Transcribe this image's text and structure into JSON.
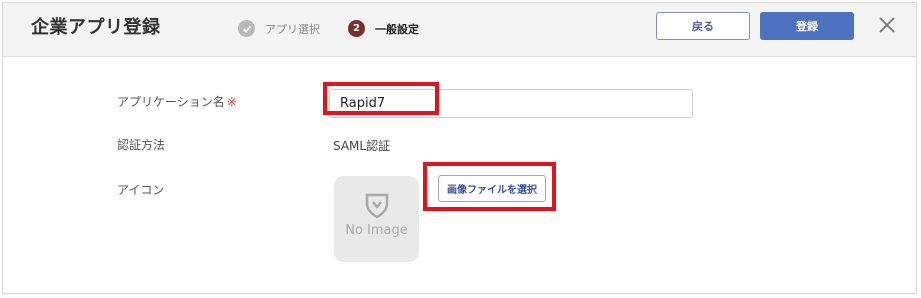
{
  "header": {
    "title": "企業アプリ登録",
    "steps": [
      {
        "number": "✓",
        "label": "アプリ選択",
        "state": "done"
      },
      {
        "number": "2",
        "label": "一般設定",
        "state": "current"
      }
    ],
    "back_label": "戻る",
    "register_label": "登録",
    "close_icon": "close-icon"
  },
  "form": {
    "app_name_label": "アプリケーション名",
    "required_mark": "※",
    "app_name_value": "Rapid7",
    "auth_label": "認証方法",
    "auth_value": "SAML認証",
    "icon_label": "アイコン",
    "no_image_text": "No Image",
    "select_image_label": "画像ファイルを選択"
  },
  "colors": {
    "accent": "#4d72c0",
    "highlight": "#e0141d",
    "step_current": "#7b2e2e",
    "required": "#d9383b"
  }
}
